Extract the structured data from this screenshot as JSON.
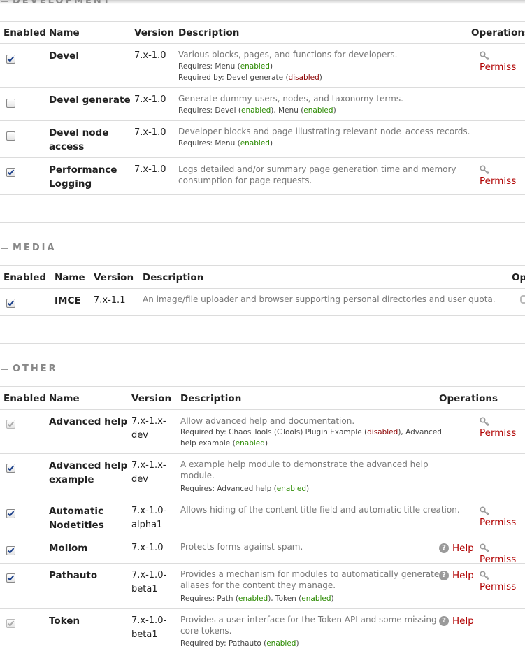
{
  "sections": {
    "development": {
      "legend": "DEVELOPMENT"
    },
    "media": {
      "legend": "MEDIA"
    },
    "other": {
      "legend": "OTHER"
    }
  },
  "headers": {
    "enabled": "Enabled",
    "name": "Name",
    "version": "Version",
    "description": "Description",
    "operations": "Operations",
    "operations_cut": "Op"
  },
  "ops": {
    "permissions": "Permiss",
    "help": "Help"
  },
  "status": {
    "enabled": "enabled",
    "disabled": "disabled"
  },
  "dev": [
    {
      "name1": "Devel",
      "name2": "",
      "version1": "7.x-1.0",
      "version2": "",
      "desc1": "Various blocks, pages, and functions for developers.",
      "desc2": "",
      "req_label": "Requires: Menu (",
      "reqby_label": "Required by: Devel generate (",
      "checked": true
    },
    {
      "name1": "Devel generate",
      "name2": "",
      "version1": "7.x-1.0",
      "desc1": "Generate dummy users, nodes, and taxonomy terms.",
      "req_a": "Requires: Devel (",
      "req_b": "), Menu (",
      "checked": false
    },
    {
      "name1": "Devel node",
      "name2": "access",
      "version1": "7.x-1.0",
      "desc1": "Developer blocks and page illustrating relevant node_access records.",
      "req_a": "Requires: Menu (",
      "checked": false
    },
    {
      "name1": "Performance",
      "name2": "Logging",
      "version1": "7.x-1.0",
      "desc1": "Logs detailed and/or summary page generation time and memory",
      "desc2": "consumption for page requests.",
      "checked": true
    }
  ],
  "media": [
    {
      "name1": "IMCE",
      "version1": "7.x-1.1",
      "desc1": "An image/file uploader and browser supporting personal directories and user quota.",
      "checked": true
    }
  ],
  "other": [
    {
      "name1": "Advanced help",
      "name2": "",
      "version1": "7.x-1.x-",
      "version2": "dev",
      "desc1": "Allow advanced help and documentation.",
      "reqby_a": "Required by: Chaos Tools (CTools) Plugin Example (",
      "reqby_b": "), Advanced",
      "reqby_c": "help example (",
      "checked": true,
      "disabled": true
    },
    {
      "name1": "Advanced help",
      "name2": "example",
      "version1": "7.x-1.x-",
      "version2": "dev",
      "desc1": "A example help module to demonstrate the advanced help",
      "desc2": "module.",
      "req_a": "Requires: Advanced help (",
      "checked": true
    },
    {
      "name1": "Automatic",
      "name2": "Nodetitles",
      "version1": "7.x-1.0-",
      "version2": "alpha1",
      "desc1": "Allows hiding of the content title field and automatic title creation.",
      "checked": true
    },
    {
      "name1": "Mollom",
      "version1": "7.x-1.0",
      "desc1": "Protects forms against spam.",
      "checked": true
    },
    {
      "name1": "Pathauto",
      "version1": "7.x-1.0-",
      "version2": "beta1",
      "desc1": "Provides a mechanism for modules to automatically generate",
      "desc2": "aliases for the content they manage.",
      "req_a": "Requires: Path (",
      "req_b": "), Token (",
      "checked": true
    },
    {
      "name1": "Token",
      "version1": "7.x-1.0-",
      "version2": "beta1",
      "desc1": "Provides a user interface for the Token API and some missing",
      "desc2": "core tokens.",
      "reqby_a": "Required by: Pathauto (",
      "checked": true,
      "disabled": true
    }
  ]
}
